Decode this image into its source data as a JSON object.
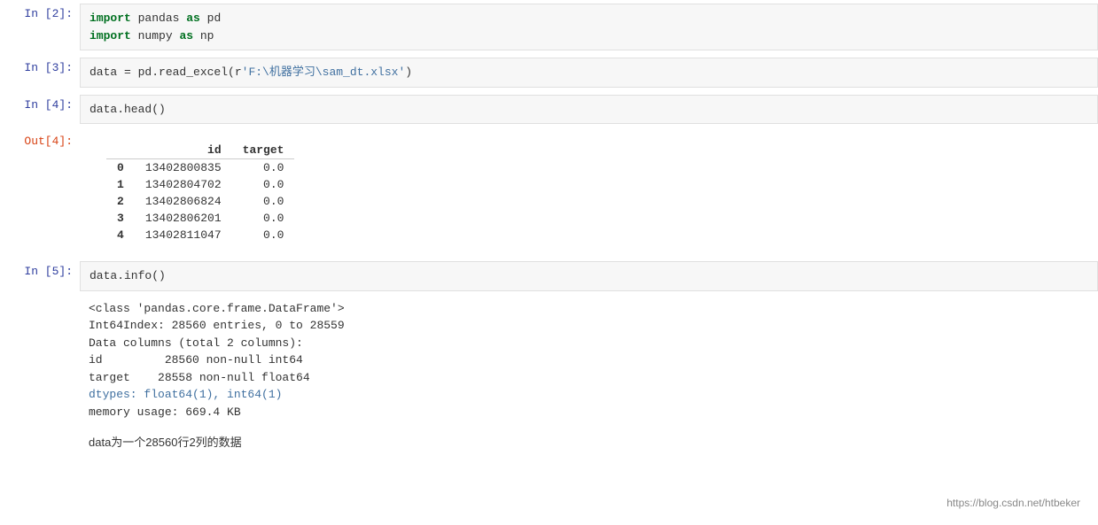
{
  "cells": [
    {
      "type": "input",
      "prompt": "In [2]:",
      "lines": [
        {
          "parts": [
            {
              "text": "import",
              "cls": "kw"
            },
            {
              "text": " pandas ",
              "cls": "mod"
            },
            {
              "text": "as",
              "cls": "kw"
            },
            {
              "text": " pd",
              "cls": "mod"
            }
          ]
        },
        {
          "parts": [
            {
              "text": "import",
              "cls": "kw"
            },
            {
              "text": " numpy ",
              "cls": "mod"
            },
            {
              "text": "as",
              "cls": "kw"
            },
            {
              "text": " np",
              "cls": "mod"
            }
          ]
        }
      ]
    },
    {
      "type": "input",
      "prompt": "In [3]:",
      "lines": [
        {
          "parts": [
            {
              "text": "data = pd.read_excel(r'F:\\机器学习\\sam_dt.xlsx')",
              "cls": "mixed3"
            }
          ]
        }
      ]
    },
    {
      "type": "input",
      "prompt": "In [4]:",
      "lines": [
        {
          "parts": [
            {
              "text": "data.head()",
              "cls": "func"
            }
          ]
        }
      ]
    },
    {
      "type": "output",
      "prompt": "Out[4]:",
      "outputType": "dataframe",
      "headers": [
        "",
        "id",
        "target"
      ],
      "rows": [
        [
          "0",
          "13402800835",
          "0.0"
        ],
        [
          "1",
          "13402804702",
          "0.0"
        ],
        [
          "2",
          "13402806824",
          "0.0"
        ],
        [
          "3",
          "13402806201",
          "0.0"
        ],
        [
          "4",
          "13402811047",
          "0.0"
        ]
      ]
    },
    {
      "type": "input",
      "prompt": "In [5]:",
      "lines": [
        {
          "parts": [
            {
              "text": "data.info()",
              "cls": "func"
            }
          ]
        }
      ]
    },
    {
      "type": "output",
      "prompt": "",
      "outputType": "info",
      "lines": [
        {
          "text": "<class 'pandas.core.frame.DataFrame'>",
          "cls": "info-line"
        },
        {
          "text": "Int64Index: 28560 entries, 0 to 28559",
          "cls": "info-line"
        },
        {
          "text": "Data columns (total 2 columns):",
          "cls": "info-line"
        },
        {
          "text": "id         28560 non-null int64",
          "cls": "info-line"
        },
        {
          "text": "target    28558 non-null float64",
          "cls": "info-line"
        },
        {
          "text": "dtypes: float64(1), int64(1)",
          "cls": "info-dtype"
        },
        {
          "text": "memory usage: 669.4 KB",
          "cls": "info-line"
        }
      ]
    },
    {
      "type": "comment",
      "text": "data为一个28560行2列的数据"
    }
  ],
  "watermark": "https://blog.csdn.net/htbeker"
}
